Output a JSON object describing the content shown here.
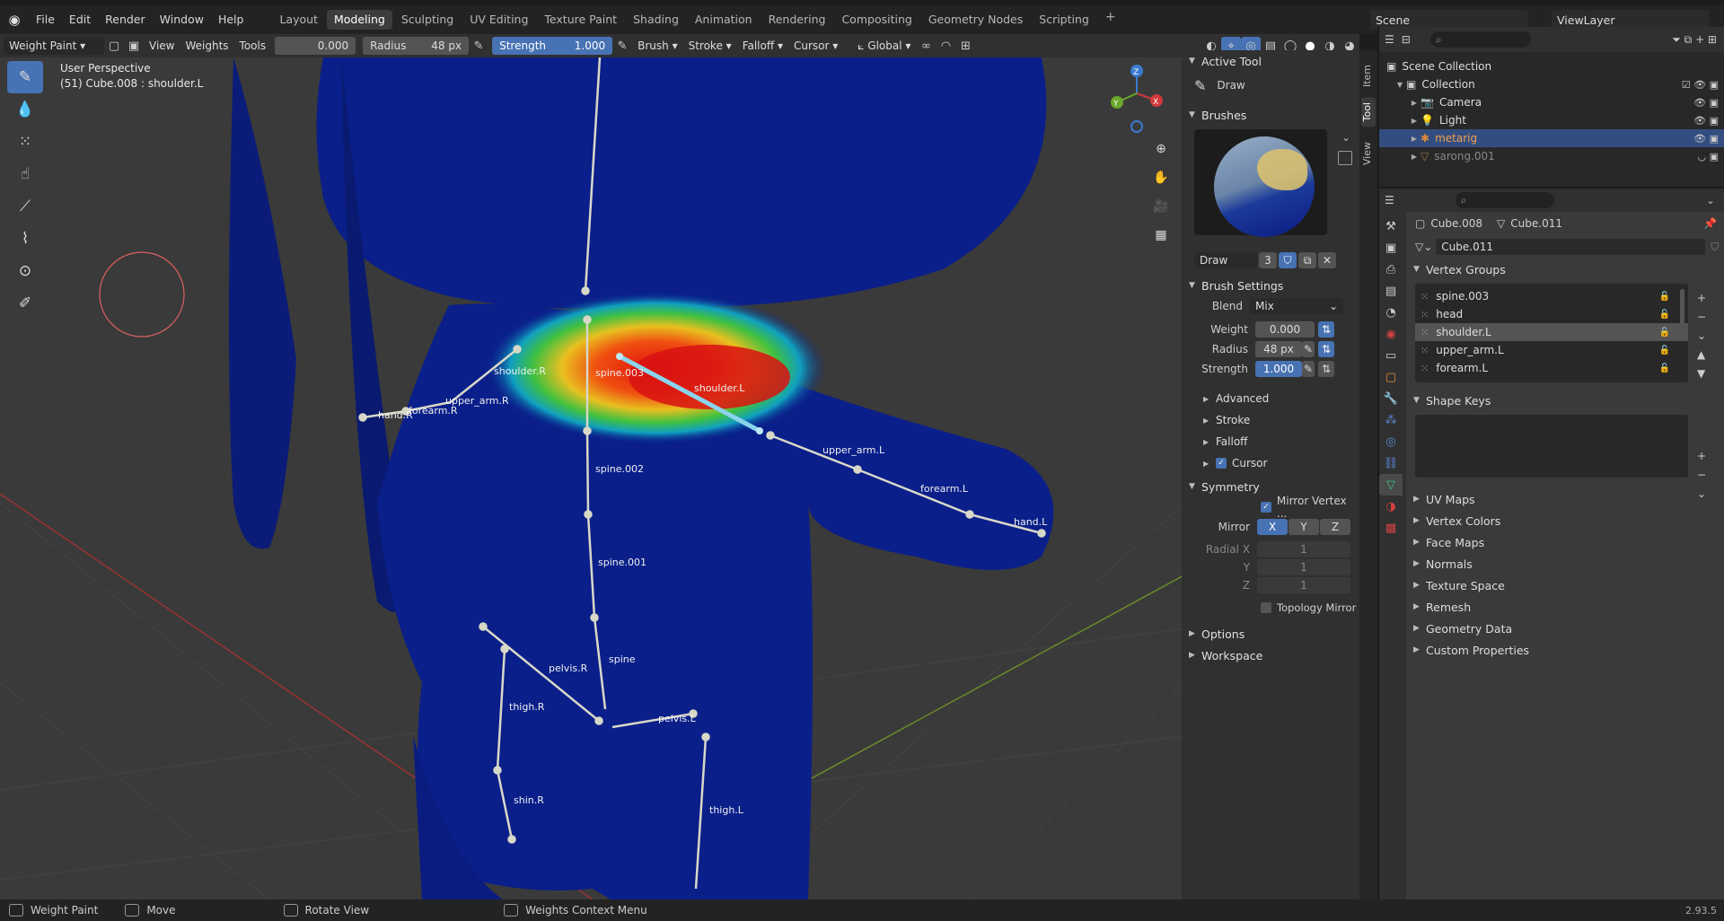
{
  "menu": [
    "File",
    "Edit",
    "Render",
    "Window",
    "Help"
  ],
  "workspaces": [
    {
      "label": "Layout",
      "active": false
    },
    {
      "label": "Modeling",
      "active": true
    },
    {
      "label": "Sculpting",
      "active": false
    },
    {
      "label": "UV Editing",
      "active": false
    },
    {
      "label": "Texture Paint",
      "active": false
    },
    {
      "label": "Shading",
      "active": false
    },
    {
      "label": "Animation",
      "active": false
    },
    {
      "label": "Rendering",
      "active": false
    },
    {
      "label": "Compositing",
      "active": false
    },
    {
      "label": "Geometry Nodes",
      "active": false
    },
    {
      "label": "Scripting",
      "active": false
    }
  ],
  "scene": {
    "name": "Scene",
    "view_layer": "ViewLayer"
  },
  "header": {
    "mode": "Weight Paint",
    "view": "View",
    "weights": "Weights",
    "tools": "Tools",
    "weight_value": "0.000",
    "radius_label": "Radius",
    "radius_value": "48 px",
    "strength_label": "Strength",
    "strength_value": "1.000",
    "brush": "Brush",
    "stroke": "Stroke",
    "falloff": "Falloff",
    "cursor": "Cursor",
    "orientation": "Global"
  },
  "viewport": {
    "perspective": "User Perspective",
    "object_info": "(51) Cube.008 : shoulder.L",
    "bones": [
      "shoulder.R",
      "upper_arm.R",
      "forearm.R",
      "hand.R",
      "spine.003",
      "shoulder.L",
      "upper_arm.L",
      "forearm.L",
      "hand.L",
      "spine.002",
      "spine.001",
      "spine",
      "pelvis.R",
      "pelvis.L",
      "thigh.R",
      "shin.R",
      "thigh.L"
    ]
  },
  "npanel": {
    "tabs": [
      "Item",
      "Tool",
      "View"
    ],
    "active_tool_title": "Active Tool",
    "active_tool": "Draw",
    "brushes_title": "Brushes",
    "brush_name": "Draw",
    "brush_users": "3",
    "brush_settings_title": "Brush Settings",
    "blend_label": "Blend",
    "blend_value": "Mix",
    "weight_label": "Weight",
    "weight_value": "0.000",
    "radius_label": "Radius",
    "radius_value": "48 px",
    "strength_label": "Strength",
    "strength_value": "1.000",
    "subpanels": [
      "Advanced",
      "Stroke",
      "Falloff"
    ],
    "cursor_label": "Cursor",
    "symmetry_title": "Symmetry",
    "mirror_vertex": "Mirror Vertex ...",
    "mirror_label": "Mirror",
    "axes": [
      "X",
      "Y",
      "Z"
    ],
    "radial_x": "Radial X",
    "radial_y": "Y",
    "radial_z": "Z",
    "radial_val": "1",
    "topology_mirror": "Topology Mirror",
    "options": "Options",
    "workspace": "Workspace"
  },
  "outliner": {
    "root": "Scene Collection",
    "collection": "Collection",
    "items": [
      {
        "name": "Camera",
        "selected": false
      },
      {
        "name": "Light",
        "selected": false
      },
      {
        "name": "metarig",
        "selected": true
      },
      {
        "name": "sarong.001",
        "selected": false
      }
    ]
  },
  "properties": {
    "object": "Cube.008",
    "mesh": "Cube.011",
    "mesh_field": "Cube.011",
    "vertex_groups_title": "Vertex Groups",
    "vertex_groups": [
      "spine.003",
      "head",
      "shoulder.L",
      "upper_arm.L",
      "forearm.L"
    ],
    "selected_group": "shoulder.L",
    "shape_keys_title": "Shape Keys",
    "sections": [
      "UV Maps",
      "Vertex Colors",
      "Face Maps",
      "Normals",
      "Texture Space",
      "Remesh",
      "Geometry Data",
      "Custom Properties"
    ]
  },
  "status": {
    "mode": "Weight Paint",
    "move": "Move",
    "rotate": "Rotate View",
    "context": "Weights Context Menu",
    "version": "2.93.5"
  },
  "colors": {
    "accent": "#4772b3",
    "selected_row": "#334d80",
    "bone": "#d8d8c8",
    "mesh_blue": "#0a1f8a"
  }
}
